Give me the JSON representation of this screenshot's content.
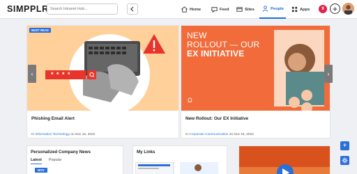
{
  "app": {
    "logo": "SIMPPLR"
  },
  "search": {
    "placeholder": "Search Intranet Hub..."
  },
  "nav": [
    {
      "label": "Home",
      "icon": "home-icon"
    },
    {
      "label": "Feed",
      "icon": "feed-icon"
    },
    {
      "label": "Sites",
      "icon": "sites-icon"
    },
    {
      "label": "People",
      "icon": "people-icon",
      "active": true
    },
    {
      "label": "Apps",
      "icon": "apps-icon"
    }
  ],
  "notifications": {
    "count": "9"
  },
  "cards": [
    {
      "badge": "MUST READ",
      "title": "Phishing Email Alert",
      "meta_prefix": "In",
      "meta_link": "Information Technology",
      "meta_suffix": "on Nov 16, 2022",
      "password_mask": "* * * *"
    },
    {
      "title": "New Rollout: Our EX Initiative",
      "meta_prefix": "In",
      "meta_link": "Corporate Communication",
      "meta_suffix": "on Nov 16, 2022",
      "headline_line1": "NEW",
      "headline_line2": "ROLLOUT — OUR",
      "headline_line3": "EX INITIATIVE",
      "logo_mark": "Ω"
    }
  ],
  "widgets": {
    "company_news": {
      "title": "Personalized Company News",
      "tabs": [
        "Latest",
        "Popular"
      ],
      "date_badge": "NOV"
    },
    "links": {
      "title": "My Links"
    }
  },
  "colors": {
    "accent": "#2b6fd9",
    "orange": "#f26b3a",
    "peach": "#ffd09a",
    "badge_red": "#e0234c"
  }
}
